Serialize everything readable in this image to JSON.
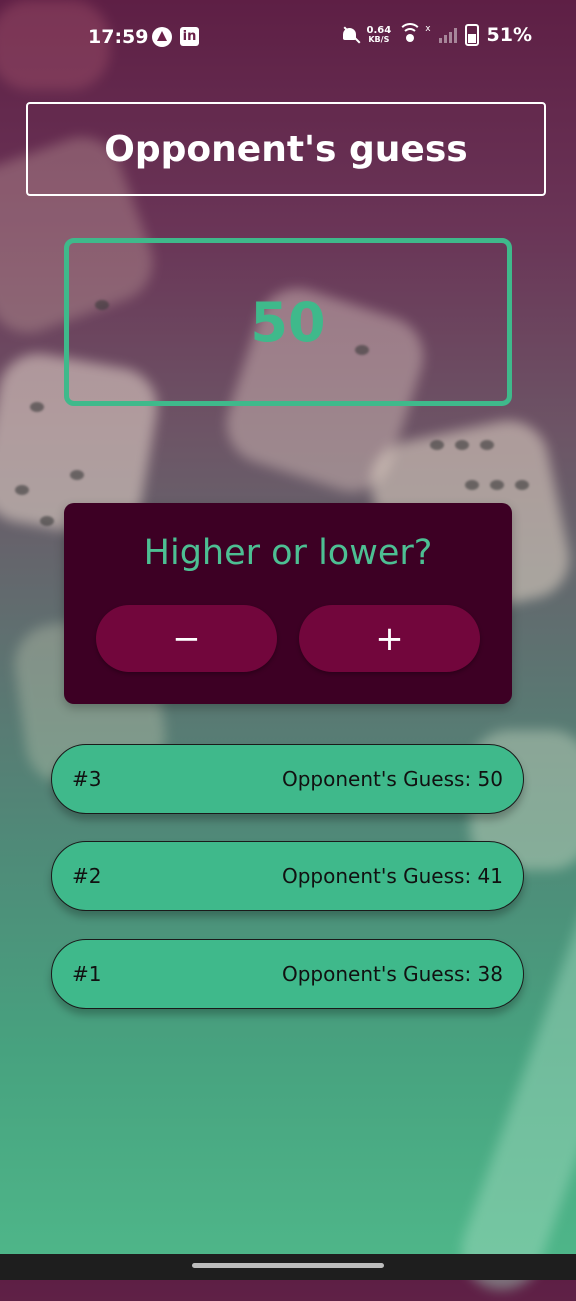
{
  "status_bar": {
    "time": "17:59",
    "net_speed_value": "0.64",
    "net_speed_unit": "KB/S",
    "signal_x": "x",
    "battery_percent": "51%"
  },
  "header": {
    "title": "Opponent's guess"
  },
  "current_guess": {
    "value": "50"
  },
  "controls": {
    "prompt": "Higher or lower?",
    "minus_label": "−",
    "plus_label": "+"
  },
  "guess_log": [
    {
      "round": "#3",
      "text": "Opponent's Guess: 50"
    },
    {
      "round": "#2",
      "text": "Opponent's Guess: 41"
    },
    {
      "round": "#1",
      "text": "Opponent's Guess: 38"
    }
  ],
  "colors": {
    "accent": "#3fb98b",
    "card_bg": "#3d0024",
    "button_bg": "#72063c"
  }
}
